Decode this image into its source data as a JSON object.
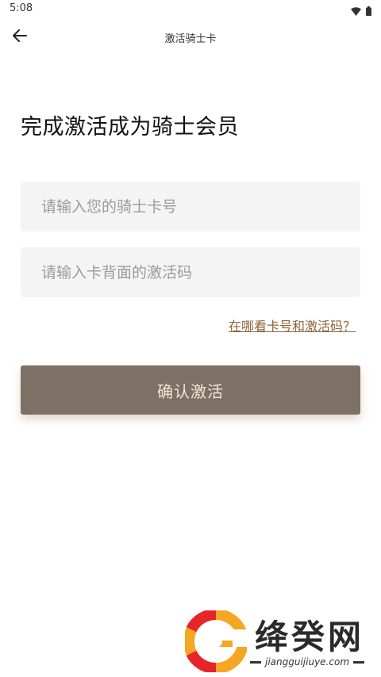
{
  "status_bar": {
    "time": "5:08",
    "icons": [
      "wifi-icon",
      "battery-icon"
    ]
  },
  "nav": {
    "title": "激活骑士卡",
    "back_icon": "arrow-left-icon"
  },
  "heading": "完成激活成为骑士会员",
  "form": {
    "card_number": {
      "placeholder": "请输入您的骑士卡号",
      "value": ""
    },
    "activation_code": {
      "placeholder": "请输入卡背面的激活码",
      "value": ""
    },
    "help_link": "在哪看卡号和激活码？",
    "submit_label": "确认激活"
  },
  "watermark": {
    "title": "绛癸网",
    "url": "jiangguijiuye.com"
  },
  "colors": {
    "button_bg": "#7d7065",
    "button_text": "#f3e6d6",
    "link": "#8d6437",
    "input_bg": "#f4f4f4"
  }
}
